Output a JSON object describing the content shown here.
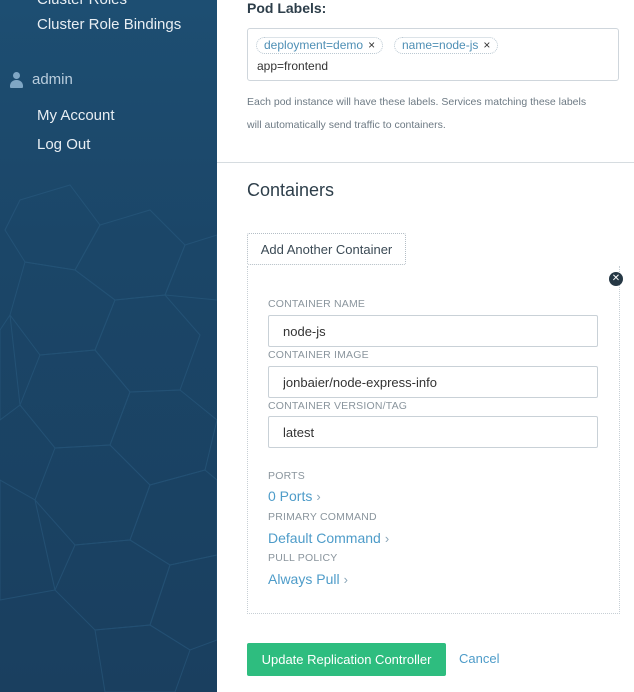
{
  "sidebar": {
    "cut_link": "Cluster Roles",
    "cluster_role_bindings": "Cluster Role Bindings",
    "user_name": "admin",
    "my_account": "My Account",
    "log_out": "Log Out"
  },
  "pod_labels": {
    "title": "Pod Labels:",
    "tags": [
      "deployment=demo",
      "name=node-js"
    ],
    "remove_glyph": "×",
    "input_value": "app=frontend",
    "help_line1": "Each pod instance will have these labels. Services matching these labels",
    "help_line2": "will automatically send traffic to containers."
  },
  "containers": {
    "title": "Containers",
    "add_button": "Add Another Container",
    "remove_glyph": "✕",
    "name_label": "CONTAINER NAME",
    "name_value": "node-js",
    "image_label": "CONTAINER IMAGE",
    "image_value": "jonbaier/node-express-info",
    "version_label": "CONTAINER VERSION/TAG",
    "version_value": "latest",
    "ports_label": "PORTS",
    "ports_value": "0 Ports",
    "command_label": "PRIMARY COMMAND",
    "command_value": "Default Command",
    "pull_label": "PULL POLICY",
    "pull_value": "Always Pull",
    "chevron": "›"
  },
  "actions": {
    "update": "Update Replication Controller",
    "cancel": "Cancel"
  },
  "colors": {
    "sidebar_bg": "#1b4668",
    "accent_link": "#4e9cc9",
    "primary_button": "#2ebd7f"
  }
}
